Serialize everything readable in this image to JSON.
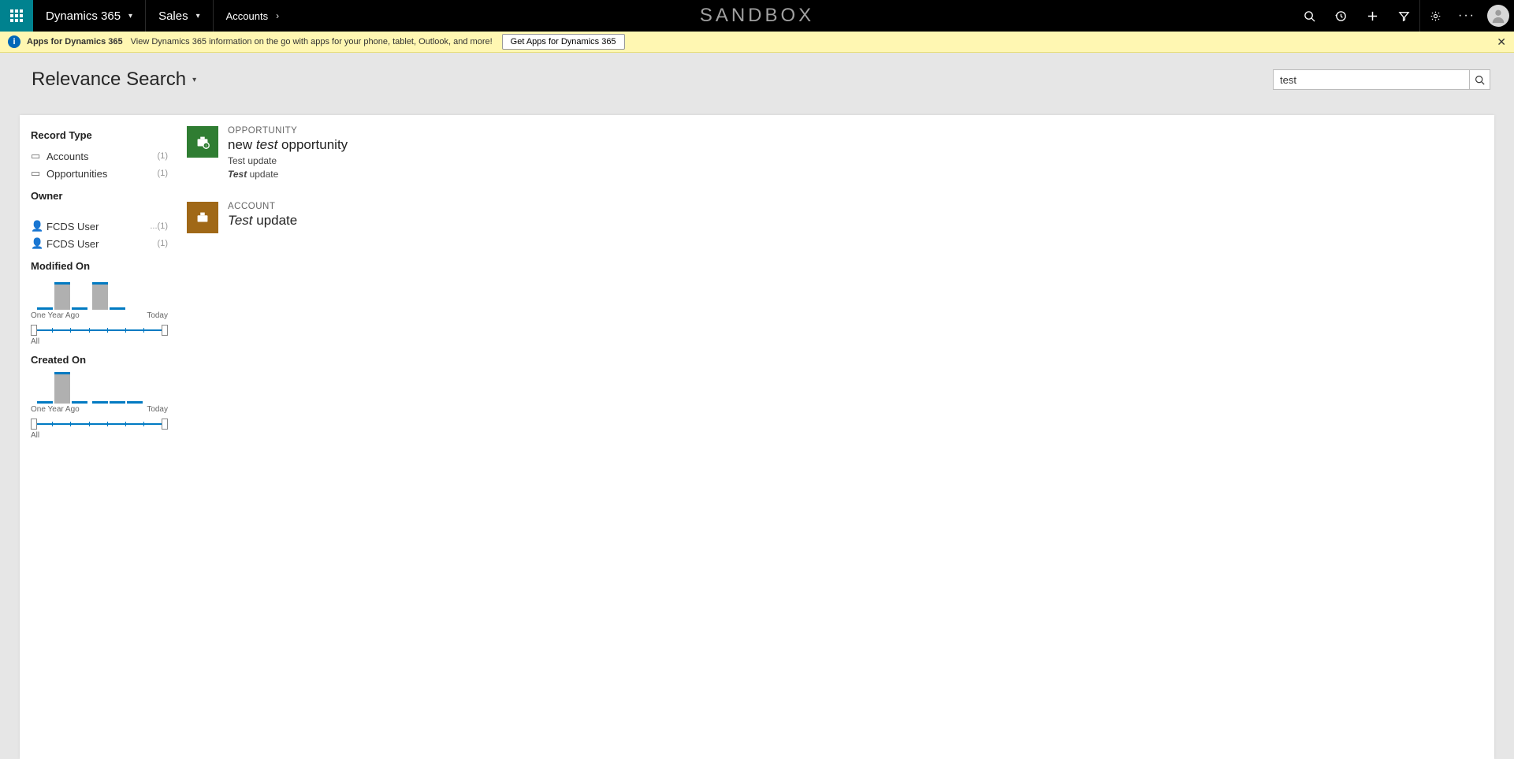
{
  "topnav": {
    "product": "Dynamics 365",
    "area": "Sales",
    "subarea": "Accounts",
    "sandbox": "SANDBOX"
  },
  "notif": {
    "title": "Apps for Dynamics 365",
    "desc": "View Dynamics 365 information on the go with apps for your phone, tablet, Outlook, and more!",
    "button": "Get Apps for Dynamics 365"
  },
  "search": {
    "heading": "Relevance Search",
    "value": "test"
  },
  "facets": {
    "record_type_header": "Record Type",
    "record_types": [
      {
        "name": "Accounts",
        "count": "(1)"
      },
      {
        "name": "Opportunities",
        "count": "(1)"
      }
    ],
    "owner_header": "Owner",
    "owners": [
      {
        "name": "FCDS User",
        "count": "...(1)"
      },
      {
        "name": "FCDS User",
        "count": "(1)"
      }
    ],
    "modified_header": "Modified On",
    "created_header": "Created On",
    "axis_old": "One Year Ago",
    "axis_new": "Today",
    "slider_all": "All"
  },
  "results": [
    {
      "type": "OPPORTUNITY",
      "title_prefix": "new ",
      "title_em": "test",
      "title_suffix": " opportunity",
      "line1": "Test update",
      "line2_em": "Test",
      "line2_rest": " update",
      "badge": "green"
    },
    {
      "type": "ACCOUNT",
      "title_prefix": "",
      "title_em": "Test",
      "title_suffix": " update",
      "line1": "",
      "line2_em": "",
      "line2_rest": "",
      "badge": "brown"
    }
  ],
  "chart_data": [
    {
      "type": "bar",
      "title": "Modified On",
      "categories": [
        "One Year Ago",
        "",
        "",
        "",
        "",
        "",
        "Today"
      ],
      "values": [
        0,
        35,
        0,
        35,
        0,
        0,
        0
      ],
      "xlabel": "",
      "ylabel": "",
      "ylim": [
        0,
        40
      ]
    },
    {
      "type": "bar",
      "title": "Created On",
      "categories": [
        "One Year Ago",
        "",
        "",
        "",
        "",
        "",
        "Today"
      ],
      "values": [
        0,
        40,
        0,
        0,
        0,
        0,
        0
      ],
      "xlabel": "",
      "ylabel": "",
      "ylim": [
        0,
        40
      ]
    }
  ]
}
